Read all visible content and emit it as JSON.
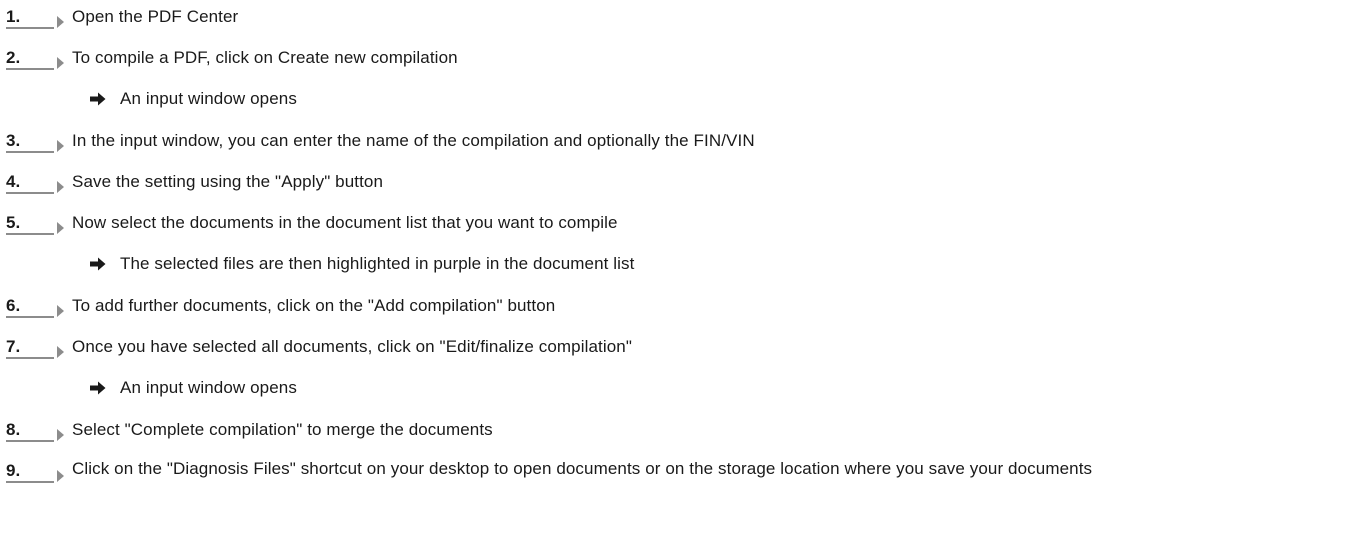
{
  "steps": [
    {
      "number": "1.",
      "text": "Open the PDF Center"
    },
    {
      "number": "2.",
      "text": "To compile a PDF, click on Create new compilation",
      "result": "An input window opens"
    },
    {
      "number": "3.",
      "text": "In the input window, you can enter the name of the compilation and optionally the FIN/VIN"
    },
    {
      "number": "4.",
      "text": "Save the setting using the \"Apply\" button"
    },
    {
      "number": "5.",
      "text": "Now select the documents in the document list that you want to compile",
      "result": "The selected files are then highlighted in purple in the document list"
    },
    {
      "number": "6.",
      "text": "To add further documents, click on the \"Add compilation\" button"
    },
    {
      "number": "7.",
      "text": "Once you have selected all documents, click on \"Edit/finalize compilation\"",
      "result": "An input window opens"
    },
    {
      "number": "8.",
      "text": "Select \"Complete compilation\" to merge the documents"
    },
    {
      "number": "9.",
      "text": "Click on the \"Diagnosis Files\" shortcut on your desktop to open documents or on the storage location where you save your documents"
    }
  ],
  "icons": {
    "step_marker": "triangle-right-icon",
    "result_marker": "arrow-right-icon"
  },
  "colors": {
    "text": "#1a1a1a",
    "marker": "#8c8c8c"
  }
}
